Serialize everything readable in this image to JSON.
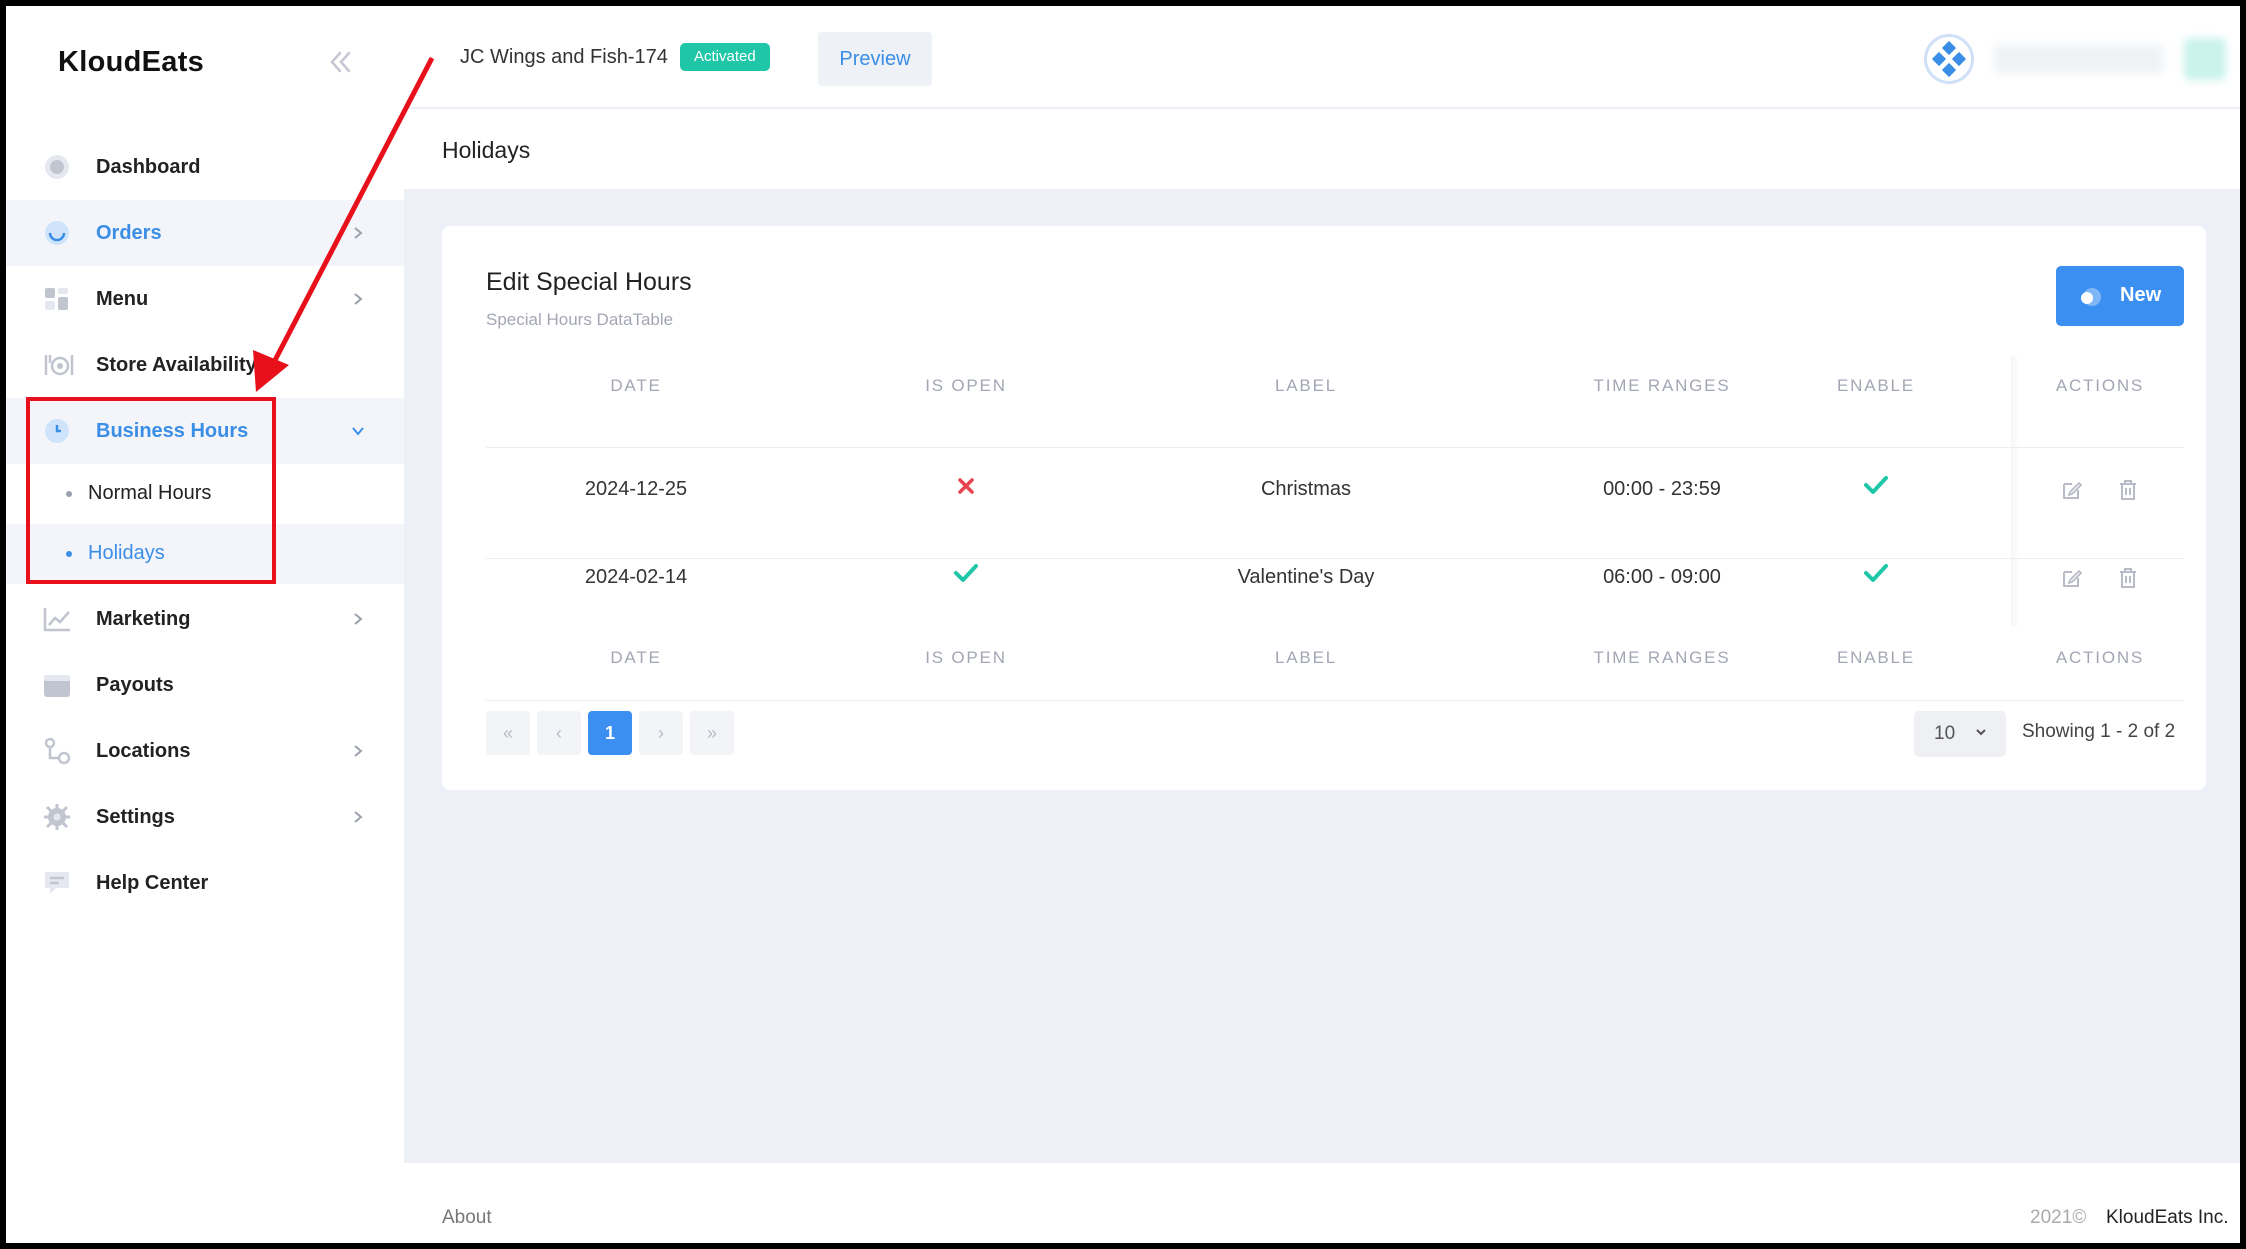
{
  "sidebar": {
    "logo": "KloudEats",
    "items": [
      {
        "label": "Dashboard",
        "icon": "dashboard-icon"
      },
      {
        "label": "Orders",
        "icon": "orders-icon"
      },
      {
        "label": "Menu",
        "icon": "menu-icon"
      },
      {
        "label": "Store Availability",
        "icon": "store-availability-icon"
      },
      {
        "label": "Business Hours",
        "icon": "clock-icon"
      },
      {
        "label": "Marketing",
        "icon": "chart-line-icon"
      },
      {
        "label": "Payouts",
        "icon": "wallet-icon"
      },
      {
        "label": "Locations",
        "icon": "locations-icon"
      },
      {
        "label": "Settings",
        "icon": "gear-icon"
      },
      {
        "label": "Help Center",
        "icon": "chat-icon"
      }
    ],
    "sub_items": [
      {
        "label": "Normal Hours"
      },
      {
        "label": "Holidays"
      }
    ]
  },
  "header": {
    "store_name": "JC Wings and Fish-174",
    "status_badge": "Activated",
    "preview_label": "Preview"
  },
  "subheader": {
    "title": "Holidays"
  },
  "card": {
    "title": "Edit Special Hours",
    "subtitle": "Special Hours DataTable",
    "new_label": "New"
  },
  "table": {
    "headers": [
      "DATE",
      "IS OPEN",
      "LABEL",
      "TIME RANGES",
      "ENABLE",
      "ACTIONS"
    ],
    "rows": [
      {
        "date": "2024-12-25",
        "is_open": false,
        "label": "Christmas",
        "time_ranges": "00:00 - 23:59",
        "enable": true
      },
      {
        "date": "2024-02-14",
        "is_open": true,
        "label": "Valentine's Day",
        "time_ranges": "06:00 - 09:00",
        "enable": true
      }
    ]
  },
  "pagination": {
    "current_page": "1",
    "per_page": "10",
    "showing": "Showing 1 - 2 of 2"
  },
  "footer": {
    "about": "About",
    "year": "2021©",
    "company": "KloudEats Inc."
  },
  "colors": {
    "accent": "#3b8ff0",
    "success": "#1fc6a8",
    "danger": "#e8424f",
    "annotation": "#e8101a"
  }
}
